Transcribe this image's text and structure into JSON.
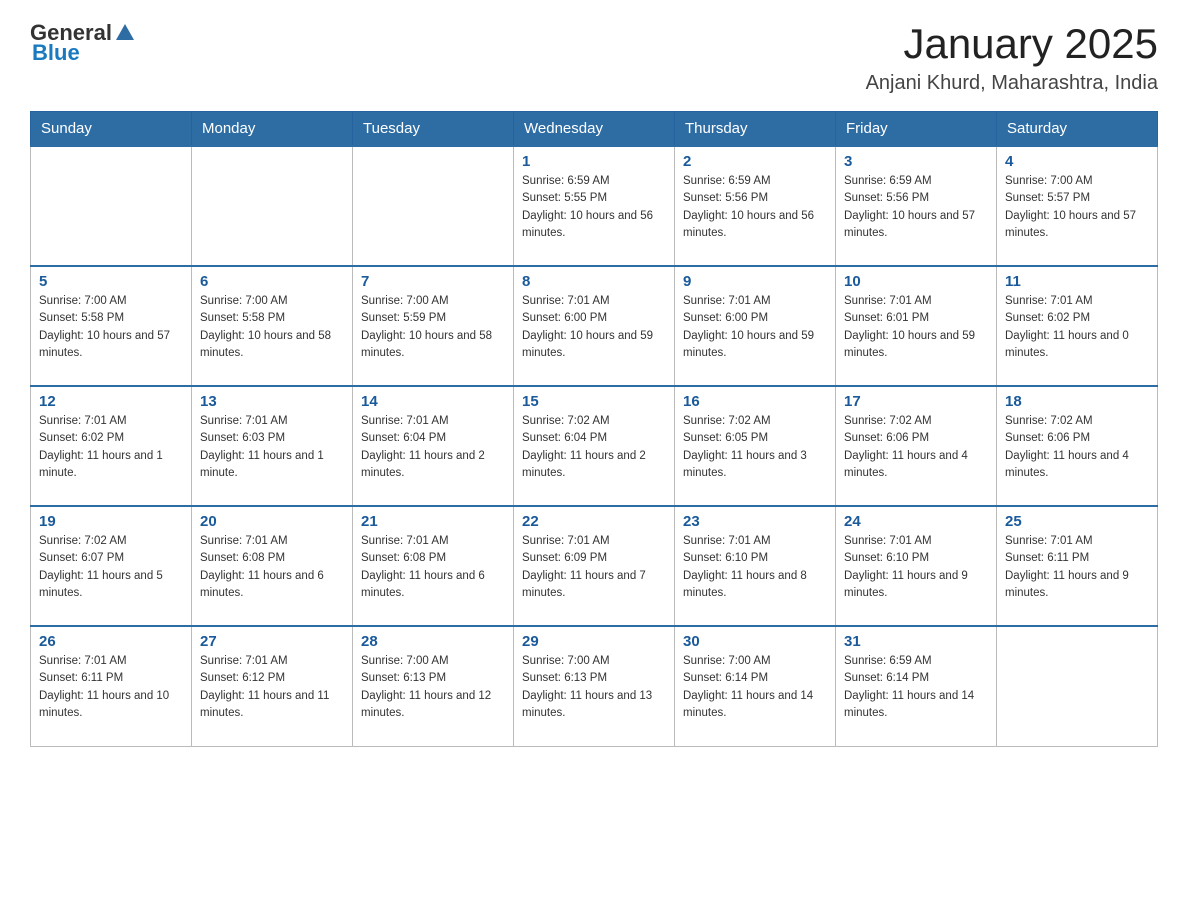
{
  "logo": {
    "text_general": "General",
    "text_blue": "Blue"
  },
  "header": {
    "title": "January 2025",
    "subtitle": "Anjani Khurd, Maharashtra, India"
  },
  "days_of_week": [
    "Sunday",
    "Monday",
    "Tuesday",
    "Wednesday",
    "Thursday",
    "Friday",
    "Saturday"
  ],
  "weeks": [
    [
      {
        "day": "",
        "sunrise": "",
        "sunset": "",
        "daylight": ""
      },
      {
        "day": "",
        "sunrise": "",
        "sunset": "",
        "daylight": ""
      },
      {
        "day": "",
        "sunrise": "",
        "sunset": "",
        "daylight": ""
      },
      {
        "day": "1",
        "sunrise": "Sunrise: 6:59 AM",
        "sunset": "Sunset: 5:55 PM",
        "daylight": "Daylight: 10 hours and 56 minutes."
      },
      {
        "day": "2",
        "sunrise": "Sunrise: 6:59 AM",
        "sunset": "Sunset: 5:56 PM",
        "daylight": "Daylight: 10 hours and 56 minutes."
      },
      {
        "day": "3",
        "sunrise": "Sunrise: 6:59 AM",
        "sunset": "Sunset: 5:56 PM",
        "daylight": "Daylight: 10 hours and 57 minutes."
      },
      {
        "day": "4",
        "sunrise": "Sunrise: 7:00 AM",
        "sunset": "Sunset: 5:57 PM",
        "daylight": "Daylight: 10 hours and 57 minutes."
      }
    ],
    [
      {
        "day": "5",
        "sunrise": "Sunrise: 7:00 AM",
        "sunset": "Sunset: 5:58 PM",
        "daylight": "Daylight: 10 hours and 57 minutes."
      },
      {
        "day": "6",
        "sunrise": "Sunrise: 7:00 AM",
        "sunset": "Sunset: 5:58 PM",
        "daylight": "Daylight: 10 hours and 58 minutes."
      },
      {
        "day": "7",
        "sunrise": "Sunrise: 7:00 AM",
        "sunset": "Sunset: 5:59 PM",
        "daylight": "Daylight: 10 hours and 58 minutes."
      },
      {
        "day": "8",
        "sunrise": "Sunrise: 7:01 AM",
        "sunset": "Sunset: 6:00 PM",
        "daylight": "Daylight: 10 hours and 59 minutes."
      },
      {
        "day": "9",
        "sunrise": "Sunrise: 7:01 AM",
        "sunset": "Sunset: 6:00 PM",
        "daylight": "Daylight: 10 hours and 59 minutes."
      },
      {
        "day": "10",
        "sunrise": "Sunrise: 7:01 AM",
        "sunset": "Sunset: 6:01 PM",
        "daylight": "Daylight: 10 hours and 59 minutes."
      },
      {
        "day": "11",
        "sunrise": "Sunrise: 7:01 AM",
        "sunset": "Sunset: 6:02 PM",
        "daylight": "Daylight: 11 hours and 0 minutes."
      }
    ],
    [
      {
        "day": "12",
        "sunrise": "Sunrise: 7:01 AM",
        "sunset": "Sunset: 6:02 PM",
        "daylight": "Daylight: 11 hours and 1 minute."
      },
      {
        "day": "13",
        "sunrise": "Sunrise: 7:01 AM",
        "sunset": "Sunset: 6:03 PM",
        "daylight": "Daylight: 11 hours and 1 minute."
      },
      {
        "day": "14",
        "sunrise": "Sunrise: 7:01 AM",
        "sunset": "Sunset: 6:04 PM",
        "daylight": "Daylight: 11 hours and 2 minutes."
      },
      {
        "day": "15",
        "sunrise": "Sunrise: 7:02 AM",
        "sunset": "Sunset: 6:04 PM",
        "daylight": "Daylight: 11 hours and 2 minutes."
      },
      {
        "day": "16",
        "sunrise": "Sunrise: 7:02 AM",
        "sunset": "Sunset: 6:05 PM",
        "daylight": "Daylight: 11 hours and 3 minutes."
      },
      {
        "day": "17",
        "sunrise": "Sunrise: 7:02 AM",
        "sunset": "Sunset: 6:06 PM",
        "daylight": "Daylight: 11 hours and 4 minutes."
      },
      {
        "day": "18",
        "sunrise": "Sunrise: 7:02 AM",
        "sunset": "Sunset: 6:06 PM",
        "daylight": "Daylight: 11 hours and 4 minutes."
      }
    ],
    [
      {
        "day": "19",
        "sunrise": "Sunrise: 7:02 AM",
        "sunset": "Sunset: 6:07 PM",
        "daylight": "Daylight: 11 hours and 5 minutes."
      },
      {
        "day": "20",
        "sunrise": "Sunrise: 7:01 AM",
        "sunset": "Sunset: 6:08 PM",
        "daylight": "Daylight: 11 hours and 6 minutes."
      },
      {
        "day": "21",
        "sunrise": "Sunrise: 7:01 AM",
        "sunset": "Sunset: 6:08 PM",
        "daylight": "Daylight: 11 hours and 6 minutes."
      },
      {
        "day": "22",
        "sunrise": "Sunrise: 7:01 AM",
        "sunset": "Sunset: 6:09 PM",
        "daylight": "Daylight: 11 hours and 7 minutes."
      },
      {
        "day": "23",
        "sunrise": "Sunrise: 7:01 AM",
        "sunset": "Sunset: 6:10 PM",
        "daylight": "Daylight: 11 hours and 8 minutes."
      },
      {
        "day": "24",
        "sunrise": "Sunrise: 7:01 AM",
        "sunset": "Sunset: 6:10 PM",
        "daylight": "Daylight: 11 hours and 9 minutes."
      },
      {
        "day": "25",
        "sunrise": "Sunrise: 7:01 AM",
        "sunset": "Sunset: 6:11 PM",
        "daylight": "Daylight: 11 hours and 9 minutes."
      }
    ],
    [
      {
        "day": "26",
        "sunrise": "Sunrise: 7:01 AM",
        "sunset": "Sunset: 6:11 PM",
        "daylight": "Daylight: 11 hours and 10 minutes."
      },
      {
        "day": "27",
        "sunrise": "Sunrise: 7:01 AM",
        "sunset": "Sunset: 6:12 PM",
        "daylight": "Daylight: 11 hours and 11 minutes."
      },
      {
        "day": "28",
        "sunrise": "Sunrise: 7:00 AM",
        "sunset": "Sunset: 6:13 PM",
        "daylight": "Daylight: 11 hours and 12 minutes."
      },
      {
        "day": "29",
        "sunrise": "Sunrise: 7:00 AM",
        "sunset": "Sunset: 6:13 PM",
        "daylight": "Daylight: 11 hours and 13 minutes."
      },
      {
        "day": "30",
        "sunrise": "Sunrise: 7:00 AM",
        "sunset": "Sunset: 6:14 PM",
        "daylight": "Daylight: 11 hours and 14 minutes."
      },
      {
        "day": "31",
        "sunrise": "Sunrise: 6:59 AM",
        "sunset": "Sunset: 6:14 PM",
        "daylight": "Daylight: 11 hours and 14 minutes."
      },
      {
        "day": "",
        "sunrise": "",
        "sunset": "",
        "daylight": ""
      }
    ]
  ]
}
